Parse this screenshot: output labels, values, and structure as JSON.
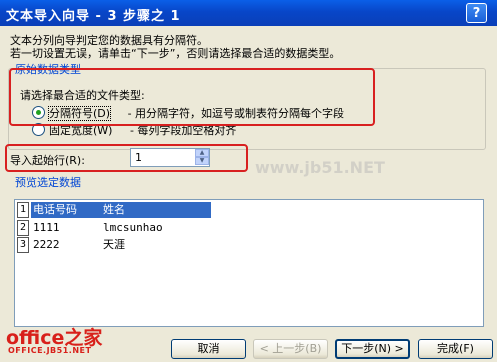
{
  "window": {
    "title": "文本导入向导 - 3 步骤之 1",
    "help_label": "?"
  },
  "intro": {
    "line1": "文本分列向导判定您的数据具有分隔符。",
    "line2": "若一切设置无误，请单击“下一步”，否则请选择最合适的数据类型。"
  },
  "original_data_type": {
    "legend": "原始数据类型",
    "prompt": "请选择最合适的文件类型:",
    "options": [
      {
        "label": "分隔符号(D)",
        "description": "- 用分隔字符，如逗号或制表符分隔每个字段",
        "checked": true
      },
      {
        "label": "固定宽度(W)",
        "description": "- 每列字段加空格对齐",
        "checked": false
      }
    ]
  },
  "start_row": {
    "label": "导入起始行(R):",
    "value": "1"
  },
  "preview": {
    "legend": "预览选定数据",
    "rows": [
      {
        "num": "1",
        "cells": [
          "电话号码",
          "姓名"
        ]
      },
      {
        "num": "2",
        "cells": [
          "1111",
          "lmcsunhao"
        ]
      },
      {
        "num": "3",
        "cells": [
          "2222",
          "天涯"
        ]
      }
    ]
  },
  "buttons": {
    "cancel": "取消",
    "back": "< 上一步(B)",
    "next": "下一步(N) >",
    "finish": "完成(F)"
  },
  "branding": {
    "logo": "office之家",
    "logo_sub": "OFFICE.JB51.NET",
    "watermark": "www.jb51.NET"
  },
  "colors": {
    "title_bar": "#0846c8",
    "highlight_box": "#d82020",
    "legend_text": "#0046d5",
    "selection": "#316ac5"
  }
}
